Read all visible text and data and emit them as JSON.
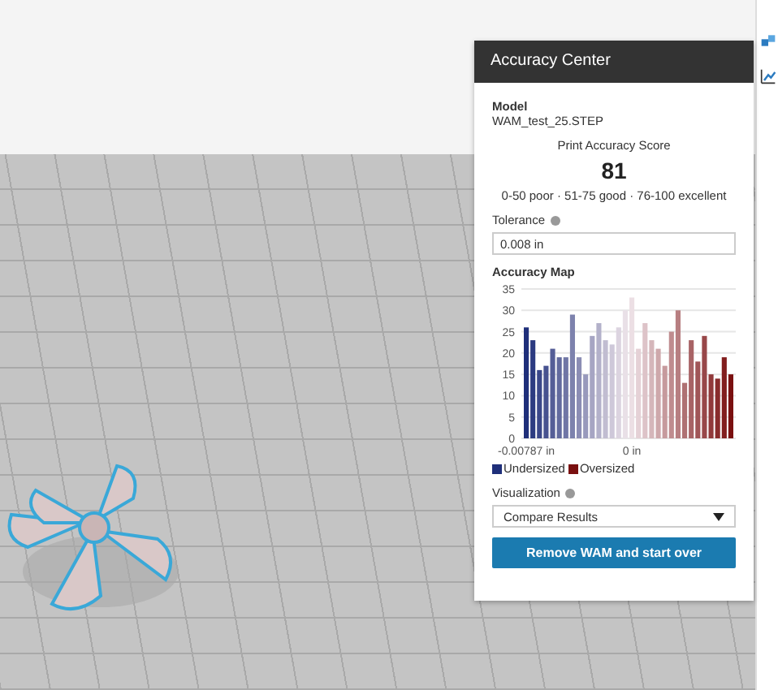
{
  "panel": {
    "title": "Accuracy Center",
    "model_label": "Model",
    "model_name": "WAM_test_25.STEP",
    "score_label": "Print Accuracy Score",
    "score": "81",
    "score_legend": "0-50 poor · 51-75 good · 76-100 excellent",
    "tolerance": {
      "label": "Tolerance",
      "value": "0.008 in"
    },
    "accuracy_map": {
      "title": "Accuracy Map",
      "chart_data": {
        "type": "bar",
        "ylim": [
          0,
          35
        ],
        "yticks": [
          0,
          5,
          10,
          15,
          20,
          25,
          30,
          35
        ],
        "grid": true,
        "xlim": [
          -0.008116,
          0.007626
        ],
        "x": [
          -0.00787,
          -0.00738,
          -0.006888,
          -0.006396,
          -0.005904,
          -0.005412,
          -0.00492,
          -0.004428,
          -0.003936,
          -0.003444,
          -0.002952,
          -0.00246,
          -0.001968,
          -0.001476,
          -0.000984,
          -0.000492,
          0,
          0.000492,
          0.000984,
          0.001476,
          0.001968,
          0.00246,
          0.002952,
          0.003444,
          0.003936,
          0.004428,
          0.00492,
          0.005412,
          0.005904,
          0.006396,
          0.006888,
          0.00738
        ],
        "xticks": [
          {
            "value": -0.00787,
            "label": "-0.00787 in"
          },
          {
            "value": 0,
            "label": "0 in"
          }
        ],
        "values": [
          26,
          23,
          16,
          17,
          21,
          19,
          19,
          29,
          19,
          15,
          24,
          27,
          23,
          22,
          26,
          30,
          33,
          21,
          27,
          23,
          21,
          17,
          25,
          30,
          13,
          23,
          18,
          24,
          15,
          14,
          19,
          15
        ]
      },
      "legend": [
        {
          "label": "Undersized",
          "color": "#1f2f7a"
        },
        {
          "label": "Oversized",
          "color": "#7a1010"
        }
      ]
    },
    "visualization": {
      "label": "Visualization",
      "value": "Compare Results"
    },
    "button": "Remove WAM and start over"
  }
}
